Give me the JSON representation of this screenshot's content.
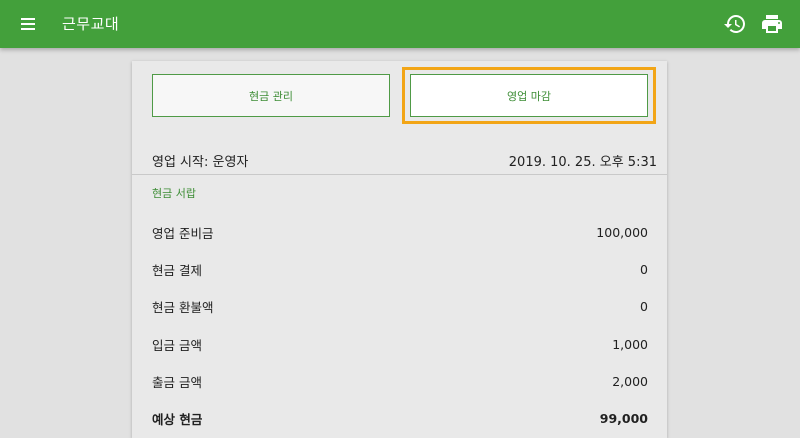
{
  "appbar": {
    "title": "근무교대",
    "menu_icon": "hamburger-menu-icon",
    "history_icon": "history-icon",
    "print_icon": "print-icon",
    "color": "#43a03b"
  },
  "actions": {
    "cash_management": "현금 관리",
    "close_sales": "영업 마감",
    "highlight_color": "#f2a516"
  },
  "sales_start": {
    "label": "영업 시작: 운영자",
    "datetime": "2019. 10. 25. 오후 5:31"
  },
  "cash_drawer": {
    "title": "현금 서랍",
    "rows": [
      {
        "label": "영업 준비금",
        "value": "100,000"
      },
      {
        "label": "현금 결제",
        "value": "0"
      },
      {
        "label": "현금 환불액",
        "value": "0"
      },
      {
        "label": "입금 금액",
        "value": "1,000"
      },
      {
        "label": "출금 금액",
        "value": "2,000"
      },
      {
        "label": "예상 현금",
        "value": "99,000"
      }
    ]
  }
}
